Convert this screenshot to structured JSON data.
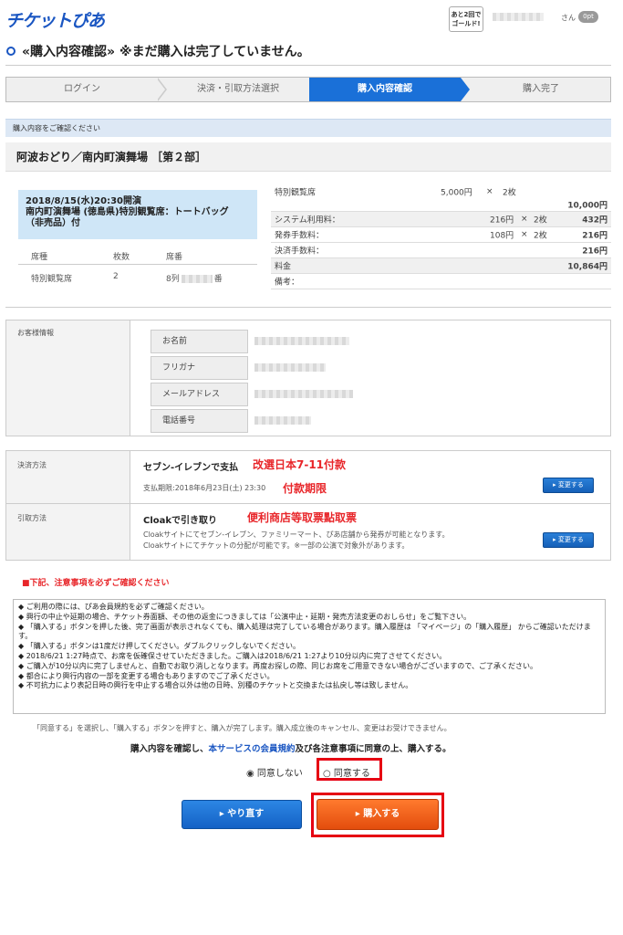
{
  "header": {
    "logo": "チケットぴあ",
    "gold_badge": "あと2回でゴールド!",
    "user_suffix": "さん",
    "points": "0pt"
  },
  "page_title": "«購入内容確認» ※まだ購入は完了していません。",
  "steps": [
    "ログイン",
    "決済・引取方法選択",
    "購入内容確認",
    "購入完了"
  ],
  "purchase": {
    "section_head": "購入内容をご確認ください",
    "event_title": "阿波おどり／南内町演舞場 ［第２部］",
    "date_lines": [
      "2018/8/15(水)20:30開演",
      "南内町演舞場 (徳島県)特別観覧席：トートバッグ",
      "（非売品）付"
    ],
    "seat_headers": [
      "席種",
      "枚数",
      "席番"
    ],
    "seat_row": {
      "type": "特別観覧席",
      "count": "2",
      "seat_prefix": "8列",
      "seat_suffix": "番"
    }
  },
  "prices": {
    "ticket_label": "特別観覧席",
    "ticket_unit": "5,000円",
    "times": "×",
    "ticket_count": "2枚",
    "ticket_total": "10,000円",
    "system_label": "システム利用料：",
    "system_unit": "216円",
    "system_count": "2枚",
    "system_total": "432円",
    "issue_label": "発券手数料：",
    "issue_unit": "108円",
    "issue_count": "2枚",
    "issue_total": "216円",
    "settle_label": "決済手数料：",
    "settle_total": "216円",
    "fee_label": "料金",
    "fee_total": "10,864円",
    "remarks_label": "備考："
  },
  "customer": {
    "section": "お客様情報",
    "fields": [
      "お名前",
      "フリガナ",
      "メールアドレス",
      "電話番号"
    ]
  },
  "payment": {
    "label": "決済方法",
    "method": "セブン-イレブンで支払",
    "note": "改選日本7-11付款",
    "deadline": "支払期限:2018年6月23日(土) 23:30",
    "deadline_note": "付款期限",
    "change": "▸ 変更する"
  },
  "pickup": {
    "label": "引取方法",
    "method": "Cloakで引き取り",
    "note": "便利商店等取票點取票",
    "desc1": "Cloakサイトにてセブン-イレブン、ファミリーマート、ぴあ店舗から発券が可能となります。",
    "desc2": "Cloakサイトにてチケットの分配が可能です。※一部の公演で対象外があります。",
    "change": "▸ 変更する"
  },
  "notice": {
    "title": "■下記、注意事項を必ずご確認ください",
    "lines": [
      "◆ ご利用の際には、ぴあ会員規約を必ずご確認ください。",
      "◆ 興行の中止や延期の場合、チケット券面額、その他の返金につきましては「公演中止・延期・発売方法変更のおしらせ」をご覧下さい。",
      "◆ 「購入する」ボタンを押した後、完了画面が表示されなくても、購入処理は完了している場合があります。購入履歴は 「マイページ」の「購入履歴」 からご確認いただけます。",
      "◆ 「購入する」ボタンは1度だけ押してください。ダブルクリックしないでください。",
      "◆ 2018/6/21 1:27時点で、お席を仮確保させていただきました。ご購入は2018/6/21 1:27より10分以内に完了させてください。",
      "◆ ご購入が10分以内に完了しませんと、自動でお取り消しとなります。再度お探しの際、同じお席をご用意できない場合がございますので、ご了承ください。",
      "◆ 都合により興行内容の一部を変更する場合もありますのでご了承ください。",
      "◆ 不可抗力により表記日時の興行を中止する場合以外は他の日時、別種のチケットと交換または払戻し等は致しません。"
    ]
  },
  "agree": {
    "instruction": "「同意する」を選択し、「購入する」ボタンを押すと、購入が完了します。購入成立後のキャンセル、変更はお受けできません。",
    "confirm_pre": "購入内容を確認し、",
    "confirm_link": "本サービスの会員規約",
    "confirm_post": "及び各注意事項に同意の上、購入する。",
    "disagree": "同意しない",
    "agree": "同意する"
  },
  "buttons": {
    "redo": "▸ やり直す",
    "buy": "▸ 購入する"
  }
}
